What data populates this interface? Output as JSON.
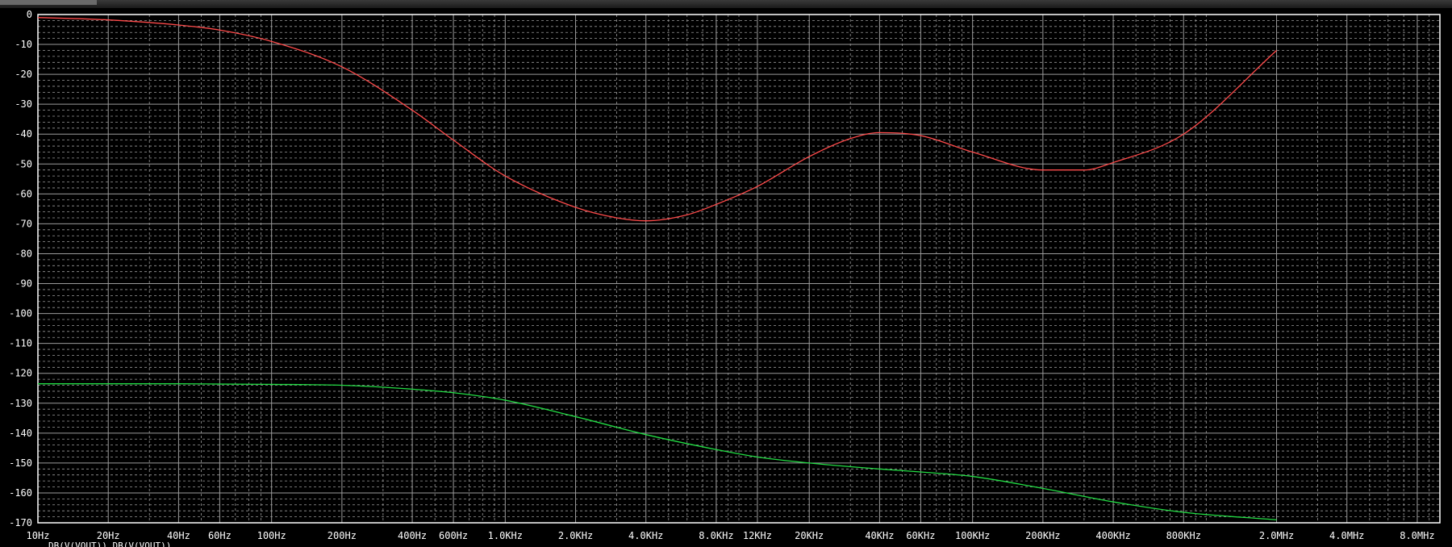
{
  "window": {
    "title": ""
  },
  "chart_data": {
    "type": "line",
    "background": "#000000",
    "axis_color": "#ffffff",
    "grid": true,
    "grid_color": "#9a9a9a",
    "xscale": "log",
    "xlim": [
      10,
      10000000
    ],
    "ylim": [
      -170,
      0
    ],
    "xlabel": "",
    "ylabel": "",
    "title": "",
    "y_ticks": [
      0,
      -10,
      -20,
      -30,
      -40,
      -50,
      -60,
      -70,
      -80,
      -90,
      -100,
      -110,
      -120,
      -130,
      -140,
      -150,
      -160,
      -170
    ],
    "y_tick_labels": [
      "0",
      "-10",
      "-20",
      "-30",
      "-40",
      "-50",
      "-60",
      "-70",
      "-80",
      "-90",
      "-100",
      "-110",
      "-120",
      "-130",
      "-140",
      "-150",
      "-160",
      "-170"
    ],
    "x_ticks": [
      10,
      20,
      40,
      60,
      100,
      200,
      400,
      600,
      1000,
      2000,
      4000,
      8000,
      12000,
      20000,
      40000,
      60000,
      100000,
      200000,
      400000,
      800000,
      2000000,
      4000000,
      8000000
    ],
    "x_tick_labels": [
      "10Hz",
      "20Hz",
      "40Hz",
      "60Hz",
      "100Hz",
      "200Hz",
      "400Hz",
      "600Hz",
      "1.0KHz",
      "2.0KHz",
      "4.0KHz",
      "8.0KHz",
      "12KHz",
      "20KHz",
      "40KHz",
      "60KHz",
      "100KHz",
      "200KHz",
      "400KHz",
      "800KHz",
      "2.0MHz",
      "4.0MHz",
      "8.0MHz"
    ],
    "legend_text": "DB(V(VOUT)) DB(V(VOUT))",
    "series": [
      {
        "color": "#ff4a4a",
        "x": [
          10,
          20,
          40,
          60,
          100,
          200,
          400,
          600,
          1000,
          2000,
          3000,
          4000,
          6000,
          8000,
          12000,
          20000,
          30000,
          40000,
          60000,
          100000,
          200000,
          300000,
          400000,
          800000,
          2000000
        ],
        "y": [
          -1,
          -1.8,
          -3.5,
          -5.2,
          -9,
          -17.5,
          -32,
          -42,
          -54,
          -64.5,
          -68,
          -69,
          -67,
          -63.5,
          -57.5,
          -47.5,
          -41.5,
          -39.5,
          -40.5,
          -46,
          -52,
          -52,
          -49.5,
          -40,
          -12
        ]
      },
      {
        "color": "#22dd44",
        "x": [
          10,
          20,
          40,
          60,
          100,
          200,
          400,
          600,
          1000,
          2000,
          4000,
          8000,
          12000,
          20000,
          40000,
          60000,
          100000,
          200000,
          400000,
          800000,
          2000000
        ],
        "y": [
          -123.5,
          -123.5,
          -123.5,
          -123.6,
          -123.7,
          -124,
          -125.3,
          -126.5,
          -129,
          -134.5,
          -140.5,
          -145.5,
          -148,
          -150,
          -152,
          -153,
          -154.5,
          -158.5,
          -163,
          -166.5,
          -169
        ]
      }
    ]
  }
}
